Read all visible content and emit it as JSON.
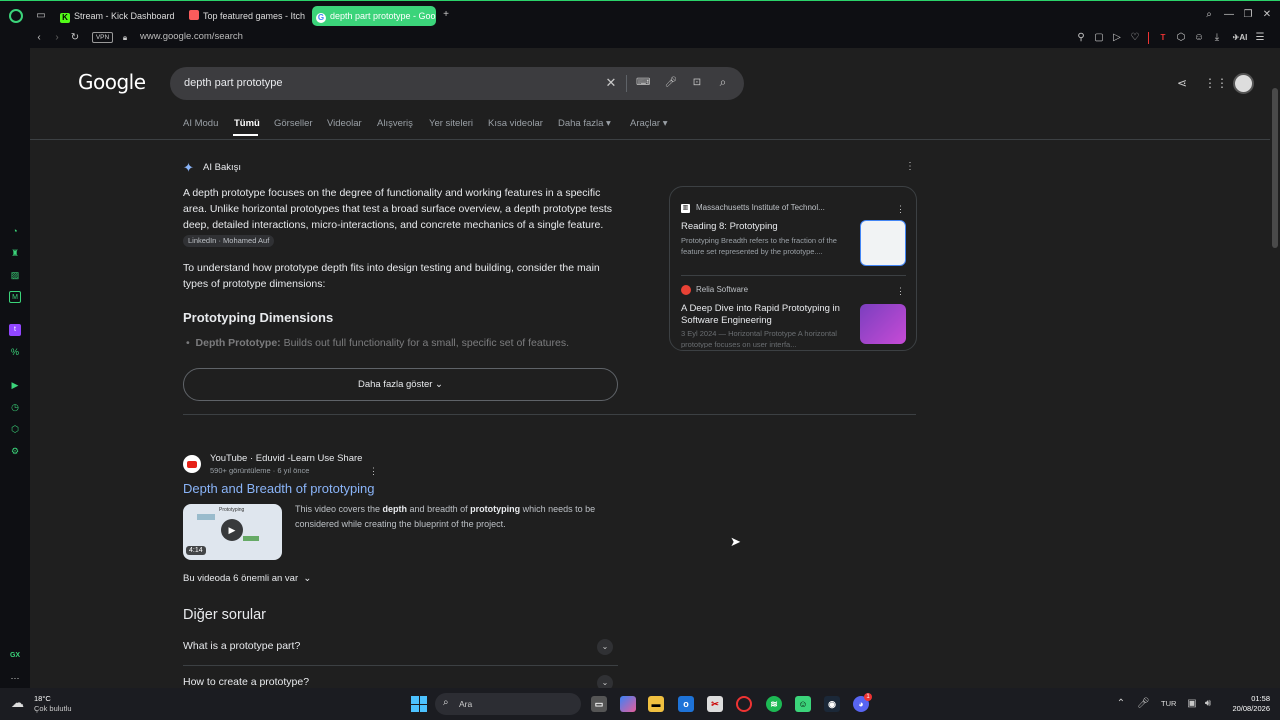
{
  "tabs": [
    {
      "label": "Stream - Kick Dashboard",
      "icon": "kick-icon",
      "color": "#53fc18"
    },
    {
      "label": "Top featured games - Itch",
      "icon": "itch-icon",
      "color": "#fa5c5c"
    },
    {
      "label": "depth part prototype - Goo",
      "icon": "google-icon",
      "color": "#ffffff"
    }
  ],
  "addressbar": {
    "vpn": "VPN",
    "url": "www.google.com/search",
    "ai": "AI"
  },
  "google": {
    "logo": "Google",
    "query": "depth part prototype",
    "nav": [
      "AI Modu",
      "Tümü",
      "Görseller",
      "Videolar",
      "Alışveriş",
      "Yer siteleri",
      "Kısa videolar",
      "Daha fazla",
      "Araçlar"
    ]
  },
  "ai": {
    "title": "AI Bakışı",
    "para1": "A depth prototype focuses on the degree of functionality and working features in a specific area. Unlike horizontal prototypes that test a broad surface overview, a depth prototype tests deep, detailed interactions, micro-interactions, and concrete mechanics of a single feature.",
    "chip": "LinkedIn · Mohamed Auf",
    "para2": "To understand how prototype depth fits into design testing and building, consider the main types of prototype dimensions:",
    "heading": "Prototyping Dimensions",
    "bullet_bold": "Depth Prototype:",
    "bullet_text": " Builds out full functionality for a small, specific set of features.",
    "show_more": "Daha fazla göster",
    "sources": [
      {
        "site": "Massachusetts Institute of Technol...",
        "title": "Reading 8: Prototyping",
        "snippet": "Prototyping Breadth refers to the fraction of the feature set represented by the prototype...."
      },
      {
        "site": "Relia Software",
        "title": "A Deep Dive into Rapid Prototyping in Software Engineering",
        "snippet": "3 Eyl 2024 — Horizontal Prototype A horizontal prototype focuses on user interfa..."
      }
    ]
  },
  "video": {
    "source": "YouTube · Eduvid -Learn Use Share",
    "meta": "590+ görüntüleme · 6 yıl önce",
    "title": "Depth and Breadth of prototyping",
    "desc_parts": [
      "This video covers the ",
      "depth",
      " and breadth of ",
      "prototyping",
      " which needs to be considered while creating the blueprint of the project."
    ],
    "duration": "4:14",
    "thumb_label": "Prototyping",
    "moments": "Bu videoda 6 önemli an var"
  },
  "paa": {
    "title": "Diğer sorular",
    "questions": [
      "What is a prototype part?",
      "How to create a prototype?"
    ]
  },
  "taskbar": {
    "temp": "18°C",
    "weather": "Çok bulutlu",
    "search": "Ara",
    "lang": "TUR",
    "time": "01:58",
    "date": "20/08/2026",
    "discord_badge": "1"
  },
  "sidebar_gx": "GX"
}
